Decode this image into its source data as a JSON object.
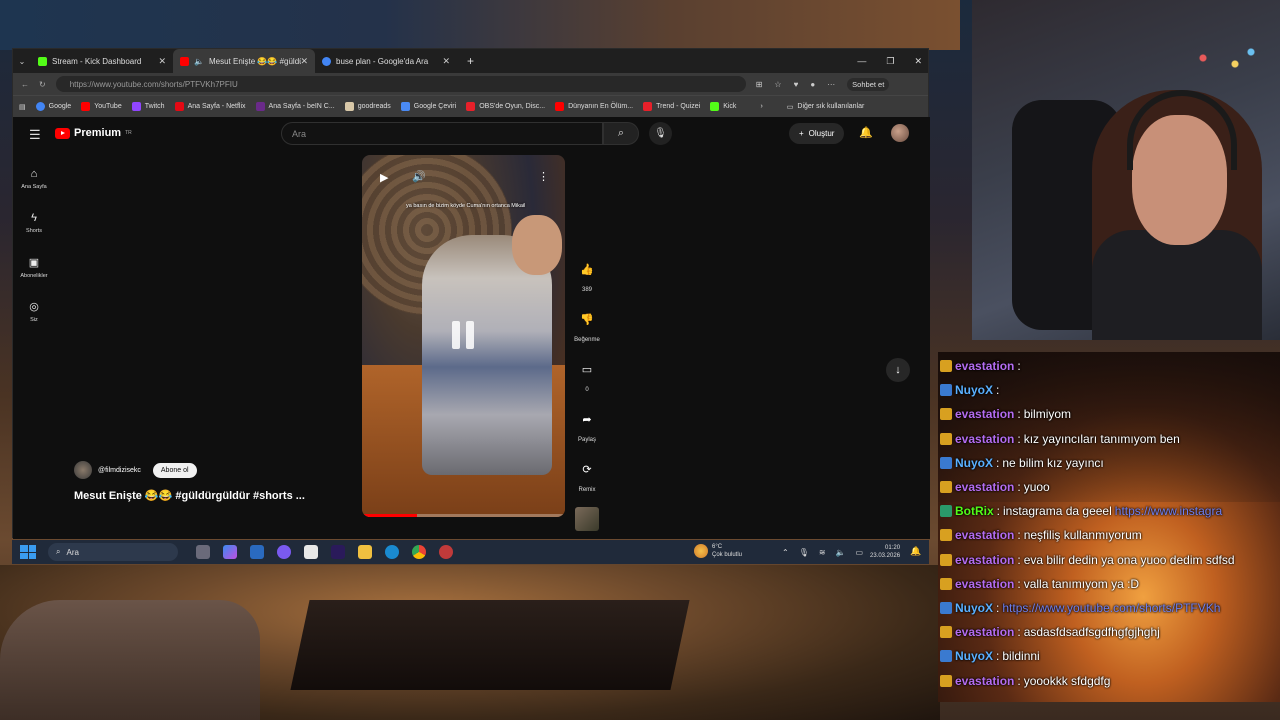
{
  "browser": {
    "tabs": [
      {
        "label": "Stream - Kick Dashboard",
        "color": "#53fc18"
      },
      {
        "label": "Mesut Enişte 😂😂 #güldürgü",
        "color": "#ff0000"
      },
      {
        "label": "buse plan - Google'da Ara",
        "color": "#4285f4"
      }
    ],
    "url": "https://www.youtube.com/shorts/PTFVKh7PFIU",
    "chat_button": "Sohbet et",
    "bookmarks": [
      "Google",
      "YouTube",
      "Twitch",
      "Ana Sayfa - Netflix",
      "Ana Sayfa - beIN C...",
      "goodreads",
      "Google Çeviri",
      "OBS'de Oyun, Disc...",
      "Dünyanın En Ölüm...",
      "Trend - Quizei",
      "Kick"
    ],
    "other_bookmarks": "Diğer sık kullanılanlar"
  },
  "youtube": {
    "logo": "Premium",
    "logo_sup": "TR",
    "search_placeholder": "Ara",
    "create_label": "Oluştur",
    "nav": [
      {
        "label": "Ana Sayfa",
        "icon": "home-icon"
      },
      {
        "label": "Shorts",
        "icon": "shorts-icon"
      },
      {
        "label": "Abonelikler",
        "icon": "subscriptions-icon"
      },
      {
        "label": "Siz",
        "icon": "you-icon"
      }
    ],
    "short": {
      "caption": "ya basın de bizim köyde Cuma'nın ortanca Mikail",
      "progress": 0.27
    },
    "actions": {
      "like_count": "389",
      "dislike_label": "Beğenme",
      "comment_count": "0",
      "share_label": "Paylaş",
      "remix_label": "Remix"
    },
    "channel": "@filmdizisekc",
    "subscribe_label": "Abone ol",
    "title": "Mesut Enişte 😂😂 #güldürgüldür #shorts ..."
  },
  "taskbar": {
    "search": "Ara",
    "weather_temp": "6°C",
    "weather_desc": "Çok bulutlu",
    "time": "01:20",
    "date": "23.03.2026"
  },
  "chat": [
    {
      "user": "evastation",
      "text": "",
      "color": "#b46cf0"
    },
    {
      "user": "NuyoX",
      "text": "",
      "color": "#5ab0ff"
    },
    {
      "user": "evastation",
      "text": "bilmiyom",
      "color": "#b46cf0"
    },
    {
      "user": "evastation",
      "text": "kız yayıncıları tanımıyom ben",
      "color": "#b46cf0"
    },
    {
      "user": "NuyoX",
      "text": "ne bilim kız yayıncı",
      "color": "#5ab0ff"
    },
    {
      "user": "evastation",
      "text": "yuoo",
      "color": "#b46cf0"
    },
    {
      "user": "BotRix",
      "text": "instagrama da geeel",
      "link": "https://www.instagra",
      "color": "#53fc18"
    },
    {
      "user": "evastation",
      "text": "neşfiliş kullanmıyorum",
      "color": "#b46cf0"
    },
    {
      "user": "evastation",
      "text": "eva bilir dedin ya ona yuoo dedim sdfsd",
      "color": "#b46cf0"
    },
    {
      "user": "evastation",
      "text": "valla tanımıyom ya :D",
      "color": "#b46cf0"
    },
    {
      "user": "NuyoX",
      "text": "",
      "link": "https://www.youtube.com/shorts/PTFVKh",
      "color": "#5ab0ff"
    },
    {
      "user": "evastation",
      "text": "asdasfdsadfsgdfhgfgjhghj",
      "color": "#b46cf0"
    },
    {
      "user": "NuyoX",
      "text": "bildinni",
      "color": "#5ab0ff"
    },
    {
      "user": "evastation",
      "text": "yoookkk sfdgdfg",
      "color": "#b46cf0"
    }
  ]
}
